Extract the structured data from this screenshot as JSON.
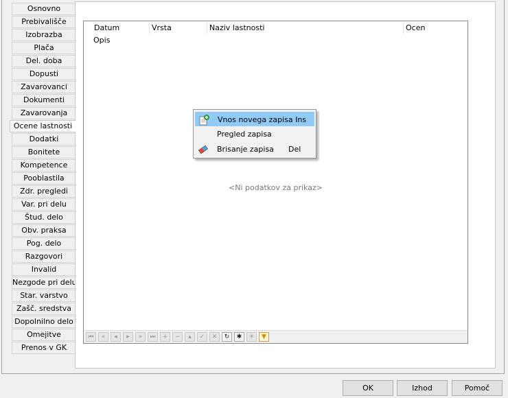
{
  "tabs": [
    {
      "label": "Osnovno"
    },
    {
      "label": "Prebivališče"
    },
    {
      "label": "Izobrazba"
    },
    {
      "label": "Plača"
    },
    {
      "label": "Del. doba"
    },
    {
      "label": "Dopusti"
    },
    {
      "label": "Zavarovanci"
    },
    {
      "label": "Dokumenti"
    },
    {
      "label": "Zavarovanja"
    },
    {
      "label": "Ocene lastnosti",
      "active": true
    },
    {
      "label": "Dodatki"
    },
    {
      "label": "Bonitete"
    },
    {
      "label": "Kompetence"
    },
    {
      "label": "Pooblastila"
    },
    {
      "label": "Zdr. pregledi"
    },
    {
      "label": "Var. pri delu"
    },
    {
      "label": "Štud. delo"
    },
    {
      "label": "Obv. praksa"
    },
    {
      "label": "Pog. delo"
    },
    {
      "label": "Razgovori"
    },
    {
      "label": "Invalid"
    },
    {
      "label": "Nezgode pri delu"
    },
    {
      "label": "Star. varstvo"
    },
    {
      "label": "Zašč. sredstva"
    },
    {
      "label": "Dopolnilno delo"
    },
    {
      "label": "Omejitve"
    },
    {
      "label": "Prenos v GK"
    }
  ],
  "grid": {
    "columns": [
      "Datum",
      "Vrsta",
      "Naziv lastnosti",
      "Ocena"
    ],
    "second_row_label": "Opis",
    "empty_text": "<Ni podatkov za prikaz>"
  },
  "navigator": {
    "buttons": [
      {
        "name": "first",
        "glyph": "⏮",
        "enabled": false
      },
      {
        "name": "prev-page",
        "glyph": "«",
        "enabled": false
      },
      {
        "name": "prev",
        "glyph": "◂",
        "enabled": false
      },
      {
        "name": "next",
        "glyph": "▸",
        "enabled": false
      },
      {
        "name": "next-page",
        "glyph": "»",
        "enabled": false
      },
      {
        "name": "last",
        "glyph": "⏭",
        "enabled": false
      },
      {
        "name": "insert",
        "glyph": "+",
        "enabled": false
      },
      {
        "name": "delete",
        "glyph": "−",
        "enabled": false
      },
      {
        "name": "edit",
        "glyph": "▴",
        "enabled": false
      },
      {
        "name": "post",
        "glyph": "✓",
        "enabled": false
      },
      {
        "name": "cancel",
        "glyph": "✕",
        "enabled": false
      },
      {
        "name": "refresh",
        "glyph": "↻",
        "enabled": true
      },
      {
        "name": "bookmark",
        "glyph": "✱",
        "enabled": true
      },
      {
        "name": "goto-bookmark",
        "glyph": "✳",
        "enabled": false
      },
      {
        "name": "filter",
        "glyph": "▼",
        "enabled": true
      }
    ]
  },
  "context_menu": {
    "items": [
      {
        "label": "Vnos novega zapisa",
        "shortcut": "Ins",
        "icon": "new-record-icon",
        "highlighted": true
      },
      {
        "label": "Pregled zapisa",
        "shortcut": "",
        "icon": "",
        "highlighted": false
      },
      {
        "label": "Brisanje zapisa",
        "shortcut": "Del",
        "icon": "eraser-icon",
        "highlighted": false
      }
    ]
  },
  "buttons": {
    "ok": "OK",
    "exit": "Izhod",
    "help": "Pomoč"
  }
}
